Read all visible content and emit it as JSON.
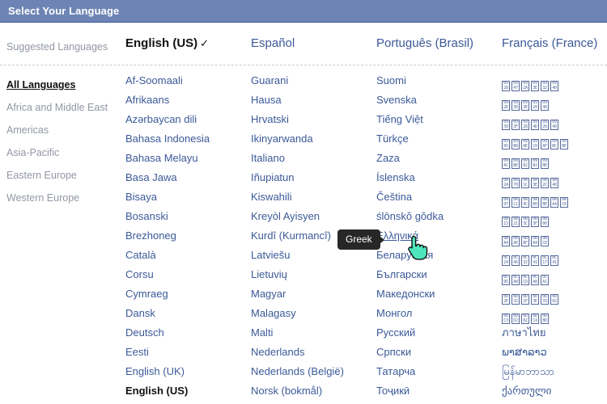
{
  "window": {
    "title": "Select Your Language"
  },
  "suggested": {
    "label": "Suggested Languages",
    "items": [
      {
        "name": "English (US)",
        "current": true,
        "check": "✓"
      },
      {
        "name": "Español",
        "current": false
      },
      {
        "name": "Português (Brasil)",
        "current": false
      },
      {
        "name": "Français (France)",
        "current": false
      }
    ]
  },
  "sidebar": {
    "items": [
      {
        "label": "All Languages",
        "active": true
      },
      {
        "label": "Africa and Middle East",
        "active": false
      },
      {
        "label": "Americas",
        "active": false
      },
      {
        "label": "Asia-Pacific",
        "active": false
      },
      {
        "label": "Eastern Europe",
        "active": false
      },
      {
        "label": "Western Europe",
        "active": false
      }
    ]
  },
  "tooltip": {
    "text": "Greek",
    "visible": true
  },
  "columns": [
    {
      "id": "column-1",
      "items": [
        {
          "text": "Af-Soomaali"
        },
        {
          "text": "Afrikaans"
        },
        {
          "text": "Azərbaycan dili"
        },
        {
          "text": "Bahasa Indonesia"
        },
        {
          "text": "Bahasa Melayu"
        },
        {
          "text": "Basa Jawa"
        },
        {
          "text": "Bisaya"
        },
        {
          "text": "Bosanski"
        },
        {
          "text": "Brezhoneg"
        },
        {
          "text": "Català"
        },
        {
          "text": "Corsu"
        },
        {
          "text": "Cymraeg"
        },
        {
          "text": "Dansk"
        },
        {
          "text": "Deutsch"
        },
        {
          "text": "Eesti"
        },
        {
          "text": "English (UK)"
        },
        {
          "text": "English (US)",
          "bold": true
        }
      ]
    },
    {
      "id": "column-2",
      "items": [
        {
          "text": "Guarani"
        },
        {
          "text": "Hausa"
        },
        {
          "text": "Hrvatski"
        },
        {
          "text": "Ikinyarwanda"
        },
        {
          "text": "Italiano"
        },
        {
          "text": "Iñupiatun"
        },
        {
          "text": "Kiswahili"
        },
        {
          "text": "Kreyòl Ayisyen"
        },
        {
          "text": "Kurdî (Kurmancî)"
        },
        {
          "text": "Latviešu"
        },
        {
          "text": "Lietuvių"
        },
        {
          "text": "Magyar"
        },
        {
          "text": "Malagasy"
        },
        {
          "text": "Malti"
        },
        {
          "text": "Nederlands"
        },
        {
          "text": "Nederlands (België)"
        },
        {
          "text": "Norsk (bokmål)"
        }
      ]
    },
    {
      "id": "column-3",
      "items": [
        {
          "text": "Suomi"
        },
        {
          "text": "Svenska"
        },
        {
          "text": "Tiếng Việt"
        },
        {
          "text": "Türkçe"
        },
        {
          "text": "Zaza"
        },
        {
          "text": "Íslenska"
        },
        {
          "text": "Čeština"
        },
        {
          "text": "ślōnskŏ gŏdka"
        },
        {
          "text": "Ελληνικά",
          "hovered": true
        },
        {
          "text": "Беларуская"
        },
        {
          "text": "Български"
        },
        {
          "text": "Македонски"
        },
        {
          "text": "Монгол"
        },
        {
          "text": "Русский"
        },
        {
          "text": "Српски"
        },
        {
          "text": "Татарча"
        },
        {
          "text": "Тоҷикӣ"
        }
      ]
    },
    {
      "id": "column-4",
      "items": [
        {
          "text": "नेपाली",
          "missing_glyphs": true,
          "codepoints": [
            "0928",
            "0947",
            "092A",
            "093E",
            "0932",
            "0940"
          ]
        },
        {
          "text": "मराठी",
          "missing_glyphs": true,
          "codepoints": [
            "092E",
            "0930",
            "093E",
            "0920",
            "0940"
          ]
        },
        {
          "text": "हिन्दी",
          "missing_glyphs": true,
          "codepoints": [
            "0939",
            "093F",
            "0928",
            "094D",
            "0926",
            "0940"
          ]
        },
        {
          "text": "অসমীয়া",
          "missing_glyphs": true,
          "codepoints": [
            "0985",
            "09B8",
            "09AE",
            "09C0",
            "09AF",
            "09BC",
            "09BE"
          ]
        },
        {
          "text": "বাংলা",
          "missing_glyphs": true,
          "codepoints": [
            "09AC",
            "09BE",
            "0982",
            "09B2",
            "09BE"
          ]
        },
        {
          "text": "ਪੰਜਾਬੀ",
          "missing_glyphs": true,
          "codepoints": [
            "0A2A",
            "0A70",
            "0A1C",
            "0A3E",
            "0A2C",
            "0A40"
          ]
        },
        {
          "text": "ગુજરાતી",
          "missing_glyphs": true,
          "codepoints": [
            "0A97",
            "0AC1",
            "0A9C",
            "0AB0",
            "0ABE",
            "0AA4",
            "0AC0"
          ]
        },
        {
          "text": "ଓଡ଼ିଆ",
          "missing_glyphs": true,
          "codepoints": [
            "0B13",
            "0B21",
            "0B3C",
            "0B3F",
            "0B06"
          ]
        },
        {
          "text": "தமிழ்",
          "missing_glyphs": true,
          "codepoints": [
            "0BA4",
            "0BAE",
            "0BBF",
            "0BB4",
            "0BCD"
          ]
        },
        {
          "text": "తెలుగు",
          "missing_glyphs": true,
          "codepoints": [
            "0C24",
            "0C46",
            "0C32",
            "0C41",
            "0C17",
            "0C41"
          ]
        },
        {
          "text": "ಕನ್ನಡ",
          "missing_glyphs": true,
          "codepoints": [
            "0C95",
            "0CA8",
            "0CCD",
            "0CA8",
            "0CA1"
          ]
        },
        {
          "text": "മലയാളം",
          "missing_glyphs": true,
          "codepoints": [
            "0D2E",
            "0D32",
            "0D2F",
            "0D3E",
            "0D33",
            "0D02"
          ]
        },
        {
          "text": "සිංහල",
          "missing_glyphs": true,
          "codepoints": [
            "0DC3",
            "0DD2",
            "0D82",
            "0DC4",
            "0DBD"
          ]
        },
        {
          "text": "ภาษาไทย"
        },
        {
          "text": "ພາສາລາວ"
        },
        {
          "text": "မြန်မာဘာသာ"
        },
        {
          "text": "ქართული"
        }
      ]
    }
  ],
  "colors": {
    "titlebar": "#6d84b4",
    "link": "#3b5998",
    "muted": "#9197a3",
    "tooltip_bg": "#272727"
  }
}
